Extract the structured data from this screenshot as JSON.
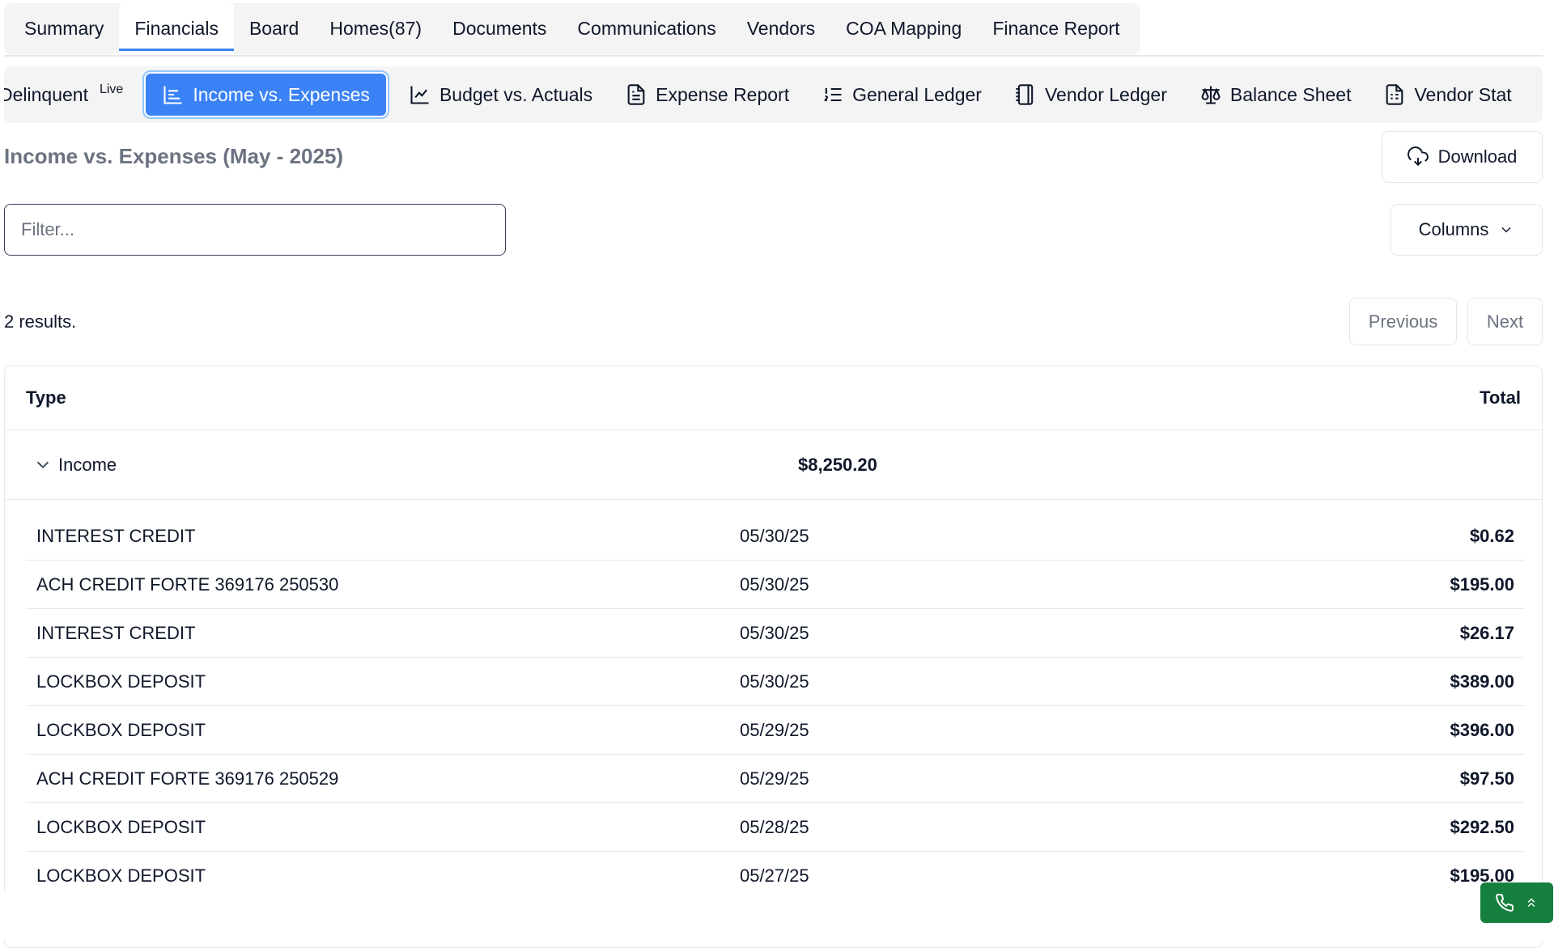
{
  "top_tabs": [
    "Summary",
    "Financials",
    "Board",
    "Homes(87)",
    "Documents",
    "Communications",
    "Vendors",
    "COA Mapping",
    "Finance Report"
  ],
  "active_top_tab": "Financials",
  "sub_tabs": {
    "delinquent": "Delinquent",
    "delinquent_badge": "Live",
    "income_vs_expenses": "Income vs. Expenses",
    "budget_vs_actuals": "Budget vs. Actuals",
    "expense_report": "Expense Report",
    "general_ledger": "General Ledger",
    "vendor_ledger": "Vendor Ledger",
    "balance_sheet": "Balance Sheet",
    "vendor_statement": "Vendor Stat"
  },
  "page": {
    "title": "Income vs. Expenses (May - 2025)",
    "download_label": "Download",
    "filter_placeholder": "Filter...",
    "columns_label": "Columns",
    "results_text": "2 results.",
    "previous_label": "Previous",
    "next_label": "Next"
  },
  "table": {
    "headers": {
      "type": "Type",
      "total": "Total"
    },
    "group": {
      "label": "Income",
      "total": "$8,250.20"
    },
    "rows": [
      {
        "desc": "INTEREST CREDIT",
        "date": "05/30/25",
        "amount": "$0.62"
      },
      {
        "desc": "ACH CREDIT FORTE 369176 250530",
        "date": "05/30/25",
        "amount": "$195.00"
      },
      {
        "desc": "INTEREST CREDIT",
        "date": "05/30/25",
        "amount": "$26.17"
      },
      {
        "desc": "LOCKBOX DEPOSIT",
        "date": "05/30/25",
        "amount": "$389.00"
      },
      {
        "desc": "LOCKBOX DEPOSIT",
        "date": "05/29/25",
        "amount": "$396.00"
      },
      {
        "desc": "ACH CREDIT FORTE 369176 250529",
        "date": "05/29/25",
        "amount": "$97.50"
      },
      {
        "desc": "LOCKBOX DEPOSIT",
        "date": "05/28/25",
        "amount": "$292.50"
      },
      {
        "desc": "LOCKBOX DEPOSIT",
        "date": "05/27/25",
        "amount": "$195.00"
      }
    ]
  },
  "colors": {
    "accent": "#3b82f6",
    "call_widget": "#15803d",
    "muted": "#6b7280"
  }
}
